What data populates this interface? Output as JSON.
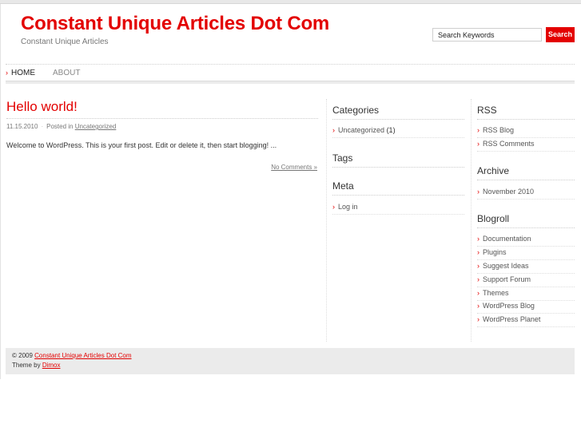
{
  "header": {
    "site_title": "Constant Unique Articles Dot Com",
    "site_description": "Constant Unique Articles"
  },
  "search": {
    "placeholder": "Search Keywords",
    "button_label": "Search"
  },
  "nav": {
    "items": [
      {
        "label": "HOME",
        "active": true
      },
      {
        "label": "ABOUT",
        "active": false
      }
    ]
  },
  "post": {
    "title": "Hello world!",
    "date": "11.15.2010",
    "posted_in_label": "Posted in",
    "category": "Uncategorized",
    "body": "Welcome to WordPress. This is your first post. Edit or delete it, then start blogging! ...",
    "comments_link": "No Comments »"
  },
  "sidebar_left": {
    "categories": {
      "heading": "Categories",
      "items": [
        {
          "label": "Uncategorized",
          "count": "(1)"
        }
      ]
    },
    "tags": {
      "heading": "Tags"
    },
    "meta": {
      "heading": "Meta",
      "items": [
        {
          "label": "Log in"
        }
      ]
    }
  },
  "sidebar_right": {
    "rss": {
      "heading": "RSS",
      "items": [
        {
          "label": "RSS Blog"
        },
        {
          "label": "RSS Comments"
        }
      ]
    },
    "archive": {
      "heading": "Archive",
      "items": [
        {
          "label": "November 2010"
        }
      ]
    },
    "blogroll": {
      "heading": "Blogroll",
      "items": [
        {
          "label": "Documentation"
        },
        {
          "label": "Plugins"
        },
        {
          "label": "Suggest Ideas"
        },
        {
          "label": "Support Forum"
        },
        {
          "label": "Themes"
        },
        {
          "label": "WordPress Blog"
        },
        {
          "label": "WordPress Planet"
        }
      ]
    }
  },
  "footer": {
    "copyright_prefix": "© 2009",
    "copyright_link": "Constant Unique Articles Dot Com",
    "theme_prefix": "Theme by",
    "theme_link": "Dimox"
  },
  "colors": {
    "accent": "#e30000",
    "footer_bg": "#ebebeb"
  },
  "icons": {
    "list_bullet": "chevron-right-icon"
  }
}
